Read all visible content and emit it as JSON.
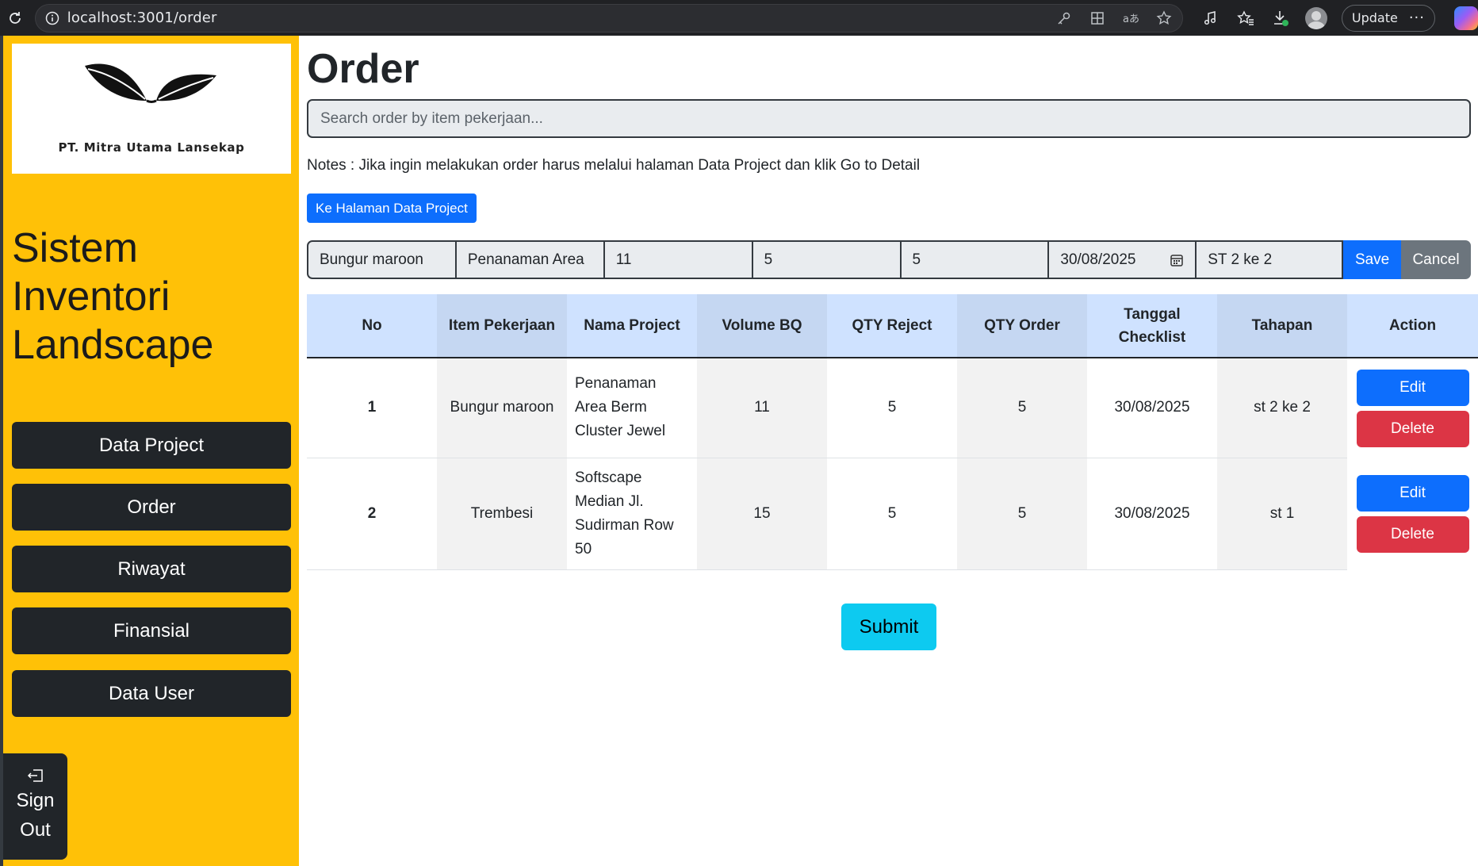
{
  "browser": {
    "url": "localhost:3001/order",
    "update_label": "Update"
  },
  "sidebar": {
    "logo_text": "PT. Mitra Utama Lansekap",
    "app_title": "Sistem Inventori Landscape",
    "nav": [
      {
        "label": "Data Project"
      },
      {
        "label": "Order"
      },
      {
        "label": "Riwayat"
      },
      {
        "label": "Finansial"
      },
      {
        "label": "Data User"
      }
    ],
    "signout_label": "Sign Out"
  },
  "main": {
    "title": "Order",
    "search_placeholder": "Search order by item pekerjaan...",
    "notes": "Notes : Jika ingin melakukan order harus melalui halaman Data Project dan klik Go to Detail",
    "data_project_button": "Ke Halaman Data Project",
    "edit_row": {
      "item_pekerjaan": "Bungur maroon",
      "nama_project": "Penanaman Area",
      "volume_bq": "11",
      "qty_reject": "5",
      "qty_order": "5",
      "tanggal": "30/08/2025",
      "tahapan": "ST 2 ke 2",
      "save_label": "Save",
      "cancel_label": "Cancel"
    },
    "table": {
      "headers": [
        "No",
        "Item Pekerjaan",
        "Nama Project",
        "Volume BQ",
        "QTY Reject",
        "QTY Order",
        "Tanggal Checklist",
        "Tahapan",
        "Action"
      ],
      "rows": [
        {
          "no": "1",
          "item": "Bungur maroon",
          "project": "Penanaman Area Berm Cluster Jewel",
          "volume": "11",
          "reject": "5",
          "order": "5",
          "tanggal": "30/08/2025",
          "tahapan": "st 2 ke 2",
          "edit": "Edit",
          "delete": "Delete"
        },
        {
          "no": "2",
          "item": "Trembesi",
          "project": "Softscape Median Jl. Sudirman Row 50",
          "volume": "15",
          "reject": "5",
          "order": "5",
          "tanggal": "30/08/2025",
          "tahapan": "st 1",
          "edit": "Edit",
          "delete": "Delete"
        }
      ]
    },
    "submit_label": "Submit"
  },
  "colors": {
    "sidebar_bg": "#ffc107",
    "nav_bg": "#212529",
    "primary": "#0d6efd",
    "danger": "#dc3545",
    "secondary": "#6c757d",
    "info": "#0dcaf0",
    "header_light": "#cfe2ff"
  },
  "icons": [
    "reload-icon",
    "info-icon",
    "key-icon",
    "apps-icon",
    "translate-icon",
    "star-icon",
    "music-icon",
    "favorites-icon",
    "download-icon",
    "profile-avatar",
    "more-icon",
    "copilot-icon",
    "calendar-icon",
    "signout-icon"
  ]
}
